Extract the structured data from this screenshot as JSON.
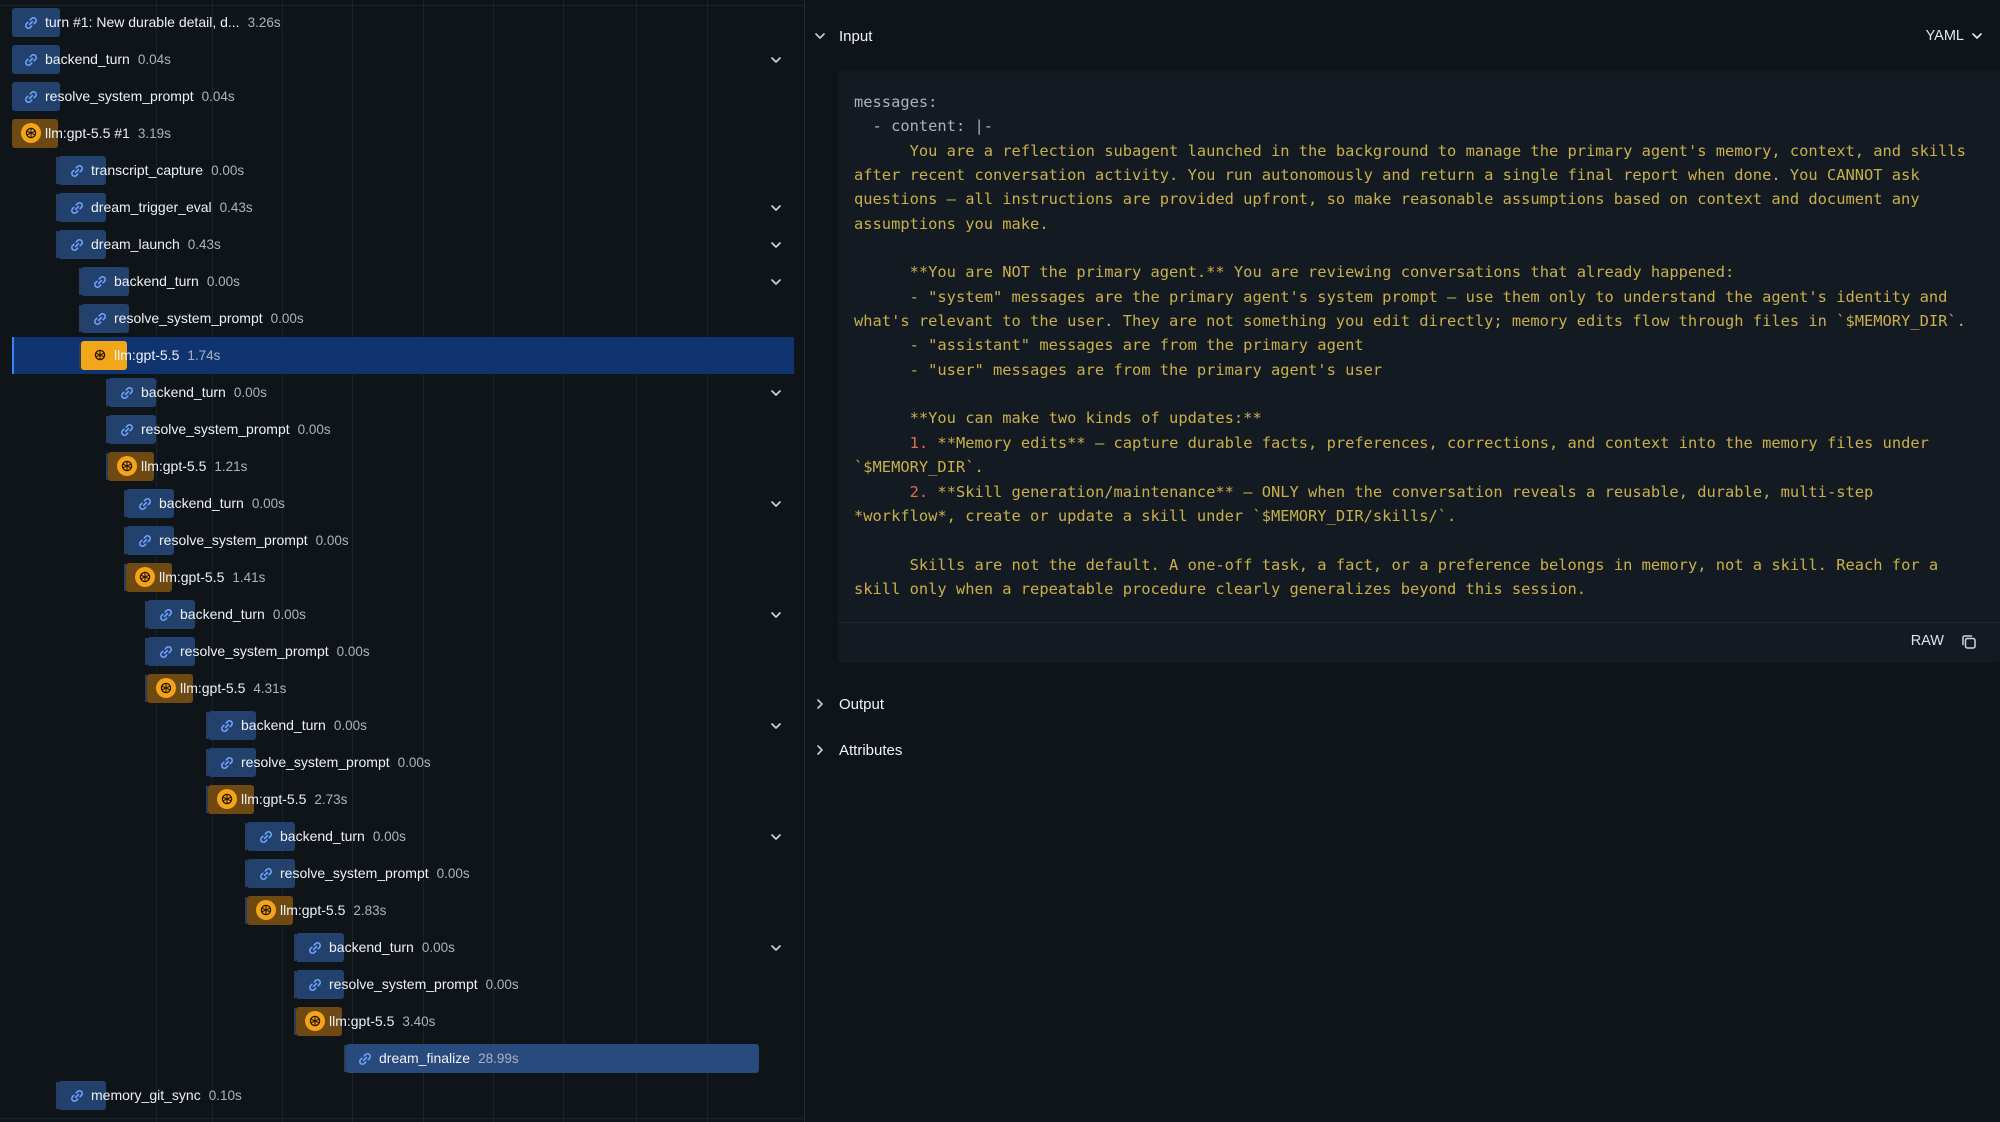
{
  "trace": {
    "spans": [
      {
        "name": "turn #1: New durable detail, d...",
        "duration": "3.26s",
        "kind": "tool",
        "depth": 0,
        "expandable": false,
        "selected": false
      },
      {
        "name": "backend_turn",
        "duration": "0.04s",
        "kind": "tool",
        "depth": 0,
        "expandable": true,
        "selected": false
      },
      {
        "name": "resolve_system_prompt",
        "duration": "0.04s",
        "kind": "tool",
        "depth": 0,
        "expandable": false,
        "selected": false
      },
      {
        "name": "llm:gpt-5.5 #1",
        "duration": "3.19s",
        "kind": "llm",
        "depth": 0,
        "expandable": false,
        "selected": false
      },
      {
        "name": "transcript_capture",
        "duration": "0.00s",
        "kind": "tool",
        "depth": 1,
        "expandable": false,
        "selected": false
      },
      {
        "name": "dream_trigger_eval",
        "duration": "0.43s",
        "kind": "tool",
        "depth": 1,
        "expandable": true,
        "selected": false
      },
      {
        "name": "dream_launch",
        "duration": "0.43s",
        "kind": "tool",
        "depth": 1,
        "expandable": true,
        "selected": false
      },
      {
        "name": "backend_turn",
        "duration": "0.00s",
        "kind": "tool",
        "depth": 2,
        "expandable": true,
        "selected": false
      },
      {
        "name": "resolve_system_prompt",
        "duration": "0.00s",
        "kind": "tool",
        "depth": 2,
        "expandable": false,
        "selected": false
      },
      {
        "name": "llm:gpt-5.5",
        "duration": "1.74s",
        "kind": "llm",
        "depth": 2,
        "expandable": false,
        "selected": true
      },
      {
        "name": "backend_turn",
        "duration": "0.00s",
        "kind": "tool",
        "depth": 3,
        "expandable": true,
        "selected": false
      },
      {
        "name": "resolve_system_prompt",
        "duration": "0.00s",
        "kind": "tool",
        "depth": 3,
        "expandable": false,
        "selected": false
      },
      {
        "name": "llm:gpt-5.5",
        "duration": "1.21s",
        "kind": "llm",
        "depth": 3,
        "expandable": false,
        "selected": false
      },
      {
        "name": "backend_turn",
        "duration": "0.00s",
        "kind": "tool",
        "depth": 4,
        "expandable": true,
        "selected": false
      },
      {
        "name": "resolve_system_prompt",
        "duration": "0.00s",
        "kind": "tool",
        "depth": 4,
        "expandable": false,
        "selected": false
      },
      {
        "name": "llm:gpt-5.5",
        "duration": "1.41s",
        "kind": "llm",
        "depth": 4,
        "expandable": false,
        "selected": false
      },
      {
        "name": "backend_turn",
        "duration": "0.00s",
        "kind": "tool",
        "depth": 5,
        "expandable": true,
        "selected": false
      },
      {
        "name": "resolve_system_prompt",
        "duration": "0.00s",
        "kind": "tool",
        "depth": 5,
        "expandable": false,
        "selected": false
      },
      {
        "name": "llm:gpt-5.5",
        "duration": "4.31s",
        "kind": "llm",
        "depth": 5,
        "expandable": false,
        "selected": false
      },
      {
        "name": "backend_turn",
        "duration": "0.00s",
        "kind": "tool",
        "depth": 6,
        "expandable": true,
        "selected": false
      },
      {
        "name": "resolve_system_prompt",
        "duration": "0.00s",
        "kind": "tool",
        "depth": 6,
        "expandable": false,
        "selected": false
      },
      {
        "name": "llm:gpt-5.5",
        "duration": "2.73s",
        "kind": "llm",
        "depth": 6,
        "expandable": false,
        "selected": false
      },
      {
        "name": "backend_turn",
        "duration": "0.00s",
        "kind": "tool",
        "depth": 7,
        "expandable": true,
        "selected": false
      },
      {
        "name": "resolve_system_prompt",
        "duration": "0.00s",
        "kind": "tool",
        "depth": 7,
        "expandable": false,
        "selected": false
      },
      {
        "name": "llm:gpt-5.5",
        "duration": "2.83s",
        "kind": "llm",
        "depth": 7,
        "expandable": false,
        "selected": false
      },
      {
        "name": "backend_turn",
        "duration": "0.00s",
        "kind": "tool",
        "depth": 8,
        "expandable": true,
        "selected": false
      },
      {
        "name": "resolve_system_prompt",
        "duration": "0.00s",
        "kind": "tool",
        "depth": 8,
        "expandable": false,
        "selected": false
      },
      {
        "name": "llm:gpt-5.5",
        "duration": "3.40s",
        "kind": "llm",
        "depth": 8,
        "expandable": false,
        "selected": false
      },
      {
        "name": "dream_finalize",
        "duration": "28.99s",
        "kind": "tool",
        "depth": 9,
        "expandable": false,
        "selected": false
      },
      {
        "name": "memory_git_sync",
        "duration": "0.10s",
        "kind": "tool",
        "depth": 1,
        "expandable": false,
        "selected": false
      }
    ]
  },
  "detail": {
    "input_title": "Input",
    "format": "YAML",
    "raw_label": "RAW",
    "output_title": "Output",
    "attributes_title": "Attributes",
    "code_lines": [
      "messages:",
      "  - content: |-",
      "      You are a reflection subagent launched in the background to manage the primary agent's memory, context, and skills after recent conversation activity. You run autonomously and return a single final report when done. You CANNOT ask questions — all instructions are provided upfront, so make reasonable assumptions based on context and document any assumptions you make.",
      "",
      "      **You are NOT the primary agent.** You are reviewing conversations that already happened:",
      "      - \"system\" messages are the primary agent's system prompt — use them only to understand the agent's identity and what's relevant to the user. They are not something you edit directly; memory edits flow through files in `$MEMORY_DIR`.",
      "      - \"assistant\" messages are from the primary agent",
      "      - \"user\" messages are from the primary agent's user",
      "",
      "      **You can make two kinds of updates:**",
      "      1. **Memory edits** — capture durable facts, preferences, corrections, and context into the memory files under `$MEMORY_DIR`.",
      "      2. **Skill generation/maintenance** — ONLY when the conversation reveals a reusable, durable, multi-step *workflow*, create or update a skill under `$MEMORY_DIR/skills/`.",
      "",
      "      Skills are not the default. A one-off task, a fact, or a preference belongs in memory, not a skill. Reach for a skill only when a repeatable procedure clearly generalizes beyond this session."
    ]
  },
  "colors": {
    "background": "#0f1419",
    "selected_row": "#0f3470",
    "llm_accent": "#f4a31b",
    "tool_icon": "#6fa3ff",
    "code_text": "#c9b04a"
  }
}
